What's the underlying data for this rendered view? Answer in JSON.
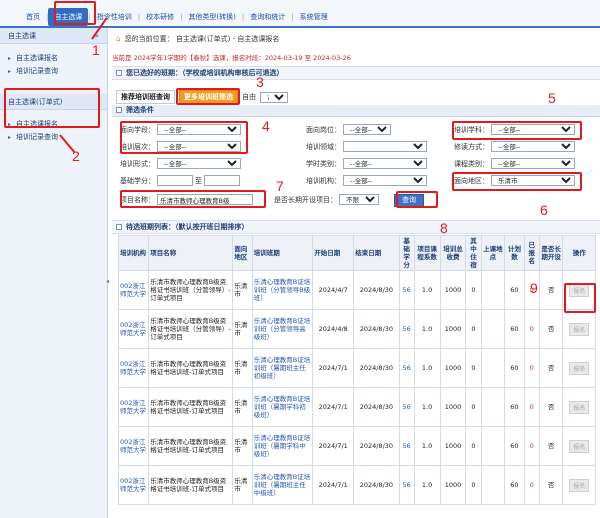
{
  "topnav": {
    "items": [
      "首页",
      "自主选课",
      "指令性培训",
      "校本研修",
      "其他类型(转换)",
      "查询和统计",
      "系统管理"
    ],
    "active_index": 1
  },
  "sidebar": {
    "head1": "自主选课",
    "head1_icon": "chevron-down-icon",
    "group1": [
      "自主选课报名",
      "培训记录查询"
    ],
    "head2": "自主选课(订单式)",
    "group2": [
      "自主选课报名",
      "培训记录查询"
    ]
  },
  "breadcrumb": {
    "label": "您的当前位置：",
    "path": "自主选课(订单式) - 自主选课报名"
  },
  "notice": "当前是 2024学年1学期的【春秋】选课，报名时段：2024-03-19 至 2024-03-26",
  "section1_title": "您已选好的班期：（学校或培训机构审核后可退选）",
  "tabs": {
    "tab1": "推荐培训班查询",
    "tab2": "更多培训班筛选",
    "week_label": "自由",
    "week_value": "?"
  },
  "filter": {
    "title": "筛选条件",
    "fields": {
      "target_course": {
        "label": "面向学段：",
        "value": "--全部--"
      },
      "target_post": {
        "label": "面向岗位：",
        "value": "--全部--"
      },
      "subject": {
        "label": "培训学科：",
        "value": "--全部--"
      },
      "level": {
        "label": "培训层次：",
        "value": "--全部--"
      },
      "area_field": {
        "label": "培训领域：",
        "value": ""
      },
      "study_mode": {
        "label": "修读方式：",
        "value": "--全部--"
      },
      "form": {
        "label": "培训形式：",
        "value": "--全部--"
      },
      "credit_type": {
        "label": "学时类别：",
        "value": "--全部--"
      },
      "course_type": {
        "label": "课程类别：",
        "value": "--全部--"
      },
      "base_credit": {
        "label": "基础学分：",
        "value": "",
        "to": "至"
      },
      "org": {
        "label": "培训机构：",
        "value": "--全部--"
      },
      "region": {
        "label": "面向地区：",
        "value": "乐清市"
      },
      "project_name": {
        "label": "项目名称：",
        "value": "乐清市教师心理教育B级"
      },
      "long_term": {
        "label": "是否长期开设项目：",
        "value": "不限"
      }
    },
    "search_label": "查询"
  },
  "section2_title": "待选班期列表：（默认按开班日期排序）",
  "table": {
    "headers": [
      "培训机构",
      "项目名称",
      "面向地区",
      "培训班期",
      "开始日期",
      "结束日期",
      "基础学分",
      "项目课程系数",
      "培训总收费",
      "其中住宿",
      "上课地点",
      "计划数",
      "已报名",
      "是否长期开设",
      "操作"
    ],
    "rows": [
      {
        "org": "002浙江师范大学",
        "project": "乐清市教师心理教育B级资格证书培训班（分管领导）-订单式项目",
        "region": "乐清市",
        "session": "乐清心理教育B证培训班（分管领导B级班）",
        "start": "2024/4/7",
        "end": "2024/8/30",
        "credit": "56",
        "ratio": "1.0",
        "fee": "1000",
        "lodging": "0",
        "place": "",
        "plan": "60",
        "enrolled": "0",
        "longterm": "否",
        "action": "报名"
      },
      {
        "org": "002浙江师范大学",
        "project": "乐清市教师心理教育B级资格证书培训班（分管领导）-订单式项目",
        "region": "乐清市",
        "session": "乐清心理教育B证培训班（分管领导高级班）",
        "start": "2024/4/8",
        "end": "2024/8/30",
        "credit": "56",
        "ratio": "1.0",
        "fee": "1000",
        "lodging": "0",
        "place": "",
        "plan": "60",
        "enrolled": "0",
        "longterm": "否",
        "action": "报名"
      },
      {
        "org": "002浙江师范大学",
        "project": "乐清市教师心理教育B级资格证书培训班-订单式项目",
        "region": "乐清市",
        "session": "乐清心理教育B证培训班（暑期班主任初级班）",
        "start": "2024/7/1",
        "end": "2024/8/30",
        "credit": "56",
        "ratio": "1.0",
        "fee": "1000",
        "lodging": "0",
        "place": "",
        "plan": "60",
        "enrolled": "0",
        "longterm": "否",
        "action": "报名"
      },
      {
        "org": "002浙江师范大学",
        "project": "乐清市教师心理教育B级资格证书培训班-订单式项目",
        "region": "乐清市",
        "session": "乐清心理教育B证培训班（暑期学科初级班）",
        "start": "2024/7/1",
        "end": "2024/8/30",
        "credit": "56",
        "ratio": "1.0",
        "fee": "1000",
        "lodging": "0",
        "place": "",
        "plan": "60",
        "enrolled": "0",
        "longterm": "否",
        "action": "报名"
      },
      {
        "org": "002浙江师范大学",
        "project": "乐清市教师心理教育B级资格证书培训班-订单式项目",
        "region": "乐清市",
        "session": "乐清心理教育B证培训班（暑期学科中级班）",
        "start": "2024/7/1",
        "end": "2024/8/30",
        "credit": "56",
        "ratio": "1.0",
        "fee": "1000",
        "lodging": "0",
        "place": "",
        "plan": "60",
        "enrolled": "0",
        "longterm": "否",
        "action": "报名"
      },
      {
        "org": "002浙江师范大学",
        "project": "乐清市教师心理教育B级资格证书培训班-订单式项目",
        "region": "乐清市",
        "session": "乐清心理教育B证培训班（暑期班主任中级班）",
        "start": "2024/7/1",
        "end": "2024/8/30",
        "credit": "56",
        "ratio": "1.0",
        "fee": "1000",
        "lodging": "0",
        "place": "",
        "plan": "60",
        "enrolled": "0",
        "longterm": "否",
        "action": "报名"
      }
    ]
  },
  "annotations": [
    "1",
    "2",
    "3",
    "4",
    "5",
    "6",
    "7",
    "8",
    "9"
  ],
  "colors": {
    "accent": "#2f6cc2",
    "annotation": "#e01b1b",
    "orange_tab": "#f29b21",
    "notice": "#c5271f"
  }
}
